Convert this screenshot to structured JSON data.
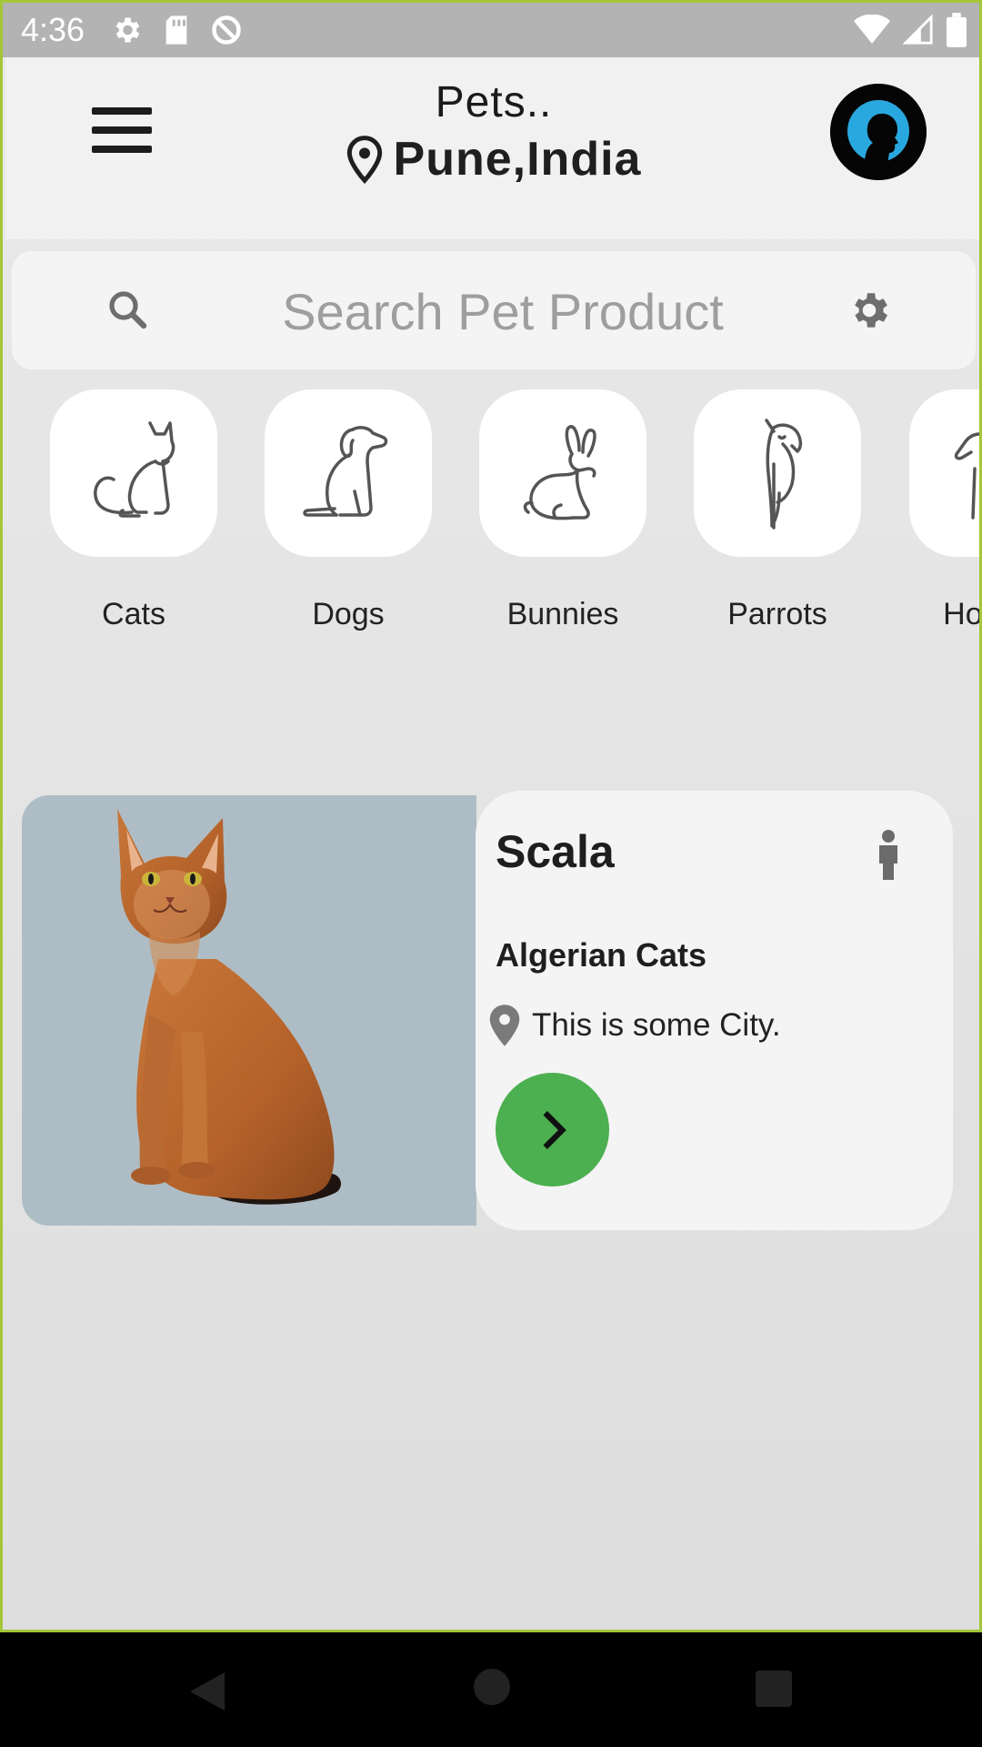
{
  "status_bar": {
    "time": "4:36",
    "icons_left": [
      "settings-icon",
      "sd-card-icon",
      "data-saver-icon"
    ],
    "icons_right": [
      "wifi-icon",
      "signal-icon",
      "battery-icon"
    ]
  },
  "header": {
    "title": "Pets..",
    "location": "Pune,India",
    "menu_icon": "menu-icon",
    "avatar_icon": "profile-avatar-icon"
  },
  "search": {
    "placeholder": "Search Pet Product",
    "search_icon": "search-icon",
    "settings_icon": "settings-icon"
  },
  "categories": [
    {
      "label": "Cats",
      "icon": "cat-icon"
    },
    {
      "label": "Dogs",
      "icon": "dog-icon"
    },
    {
      "label": "Bunnies",
      "icon": "bunny-icon"
    },
    {
      "label": "Parrots",
      "icon": "parrot-icon"
    },
    {
      "label": "Horses",
      "icon": "horse-icon"
    }
  ],
  "pet_card": {
    "name": "Scala",
    "breed": "Algerian Cats",
    "location": "This is some City.",
    "gender_icon": "male-icon",
    "action_icon": "chevron-right-icon",
    "colors": {
      "image_bg": "#aebdc5",
      "button": "#4caf50"
    }
  },
  "nav": {
    "back_icon": "back-icon",
    "home_icon": "home-icon",
    "recents_icon": "recents-icon"
  }
}
